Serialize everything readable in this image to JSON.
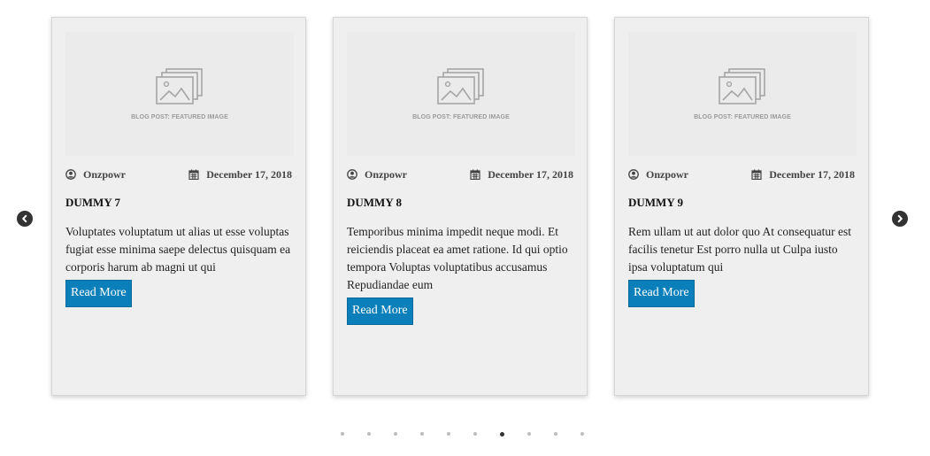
{
  "thumb_caption": "BLOG POST: FEATURED IMAGE",
  "read_more_label": "Read More",
  "posts": [
    {
      "author": "Onzpowr",
      "date": "December 17, 2018",
      "title": "DUMMY 7",
      "excerpt": "Voluptates voluptatum ut alias ut esse voluptas fugiat esse minima saepe delectus quisquam ea corporis harum ab magni ut qui"
    },
    {
      "author": "Onzpowr",
      "date": "December 17, 2018",
      "title": "DUMMY 8",
      "excerpt": "Temporibus minima impedit neque modi. Et reiciendis placeat ea amet ratione. Id qui optio tempora Voluptas voluptatibus accusamus Repudiandae eum"
    },
    {
      "author": "Onzpowr",
      "date": "December 17, 2018",
      "title": "DUMMY 9",
      "excerpt": "Rem ullam ut aut dolor quo At consequatur est facilis tenetur Est porro nulla ut Culpa iusto ipsa voluptatum qui"
    }
  ],
  "pagination": {
    "total": 10,
    "active_index": 6
  },
  "colors": {
    "button": "#0a7fba",
    "card_bg": "#efefef",
    "arrow": "#333333",
    "dot": "#bdbdbd",
    "dot_active": "#333333"
  },
  "icons": {
    "prev": "chevron-left-icon",
    "next": "chevron-right-icon",
    "author": "user-circle-icon",
    "date": "calendar-icon",
    "thumb": "image-stack-icon"
  }
}
